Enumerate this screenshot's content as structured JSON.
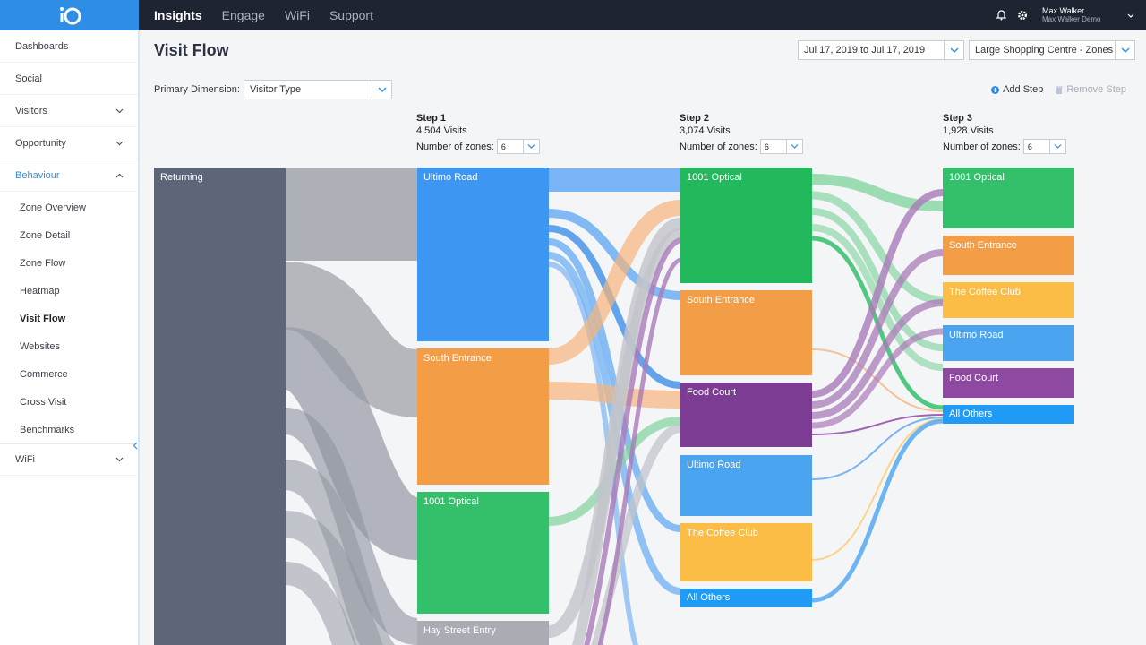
{
  "topbar": {
    "nav": [
      {
        "label": "Insights",
        "active": true
      },
      {
        "label": "Engage",
        "active": false
      },
      {
        "label": "WiFi",
        "active": false
      },
      {
        "label": "Support",
        "active": false
      }
    ],
    "user_name": "Max Walker",
    "user_org": "Max Walker Demo"
  },
  "sidebar": {
    "items": [
      {
        "label": "Dashboards"
      },
      {
        "label": "Social"
      },
      {
        "label": "Visitors"
      },
      {
        "label": "Opportunity"
      },
      {
        "label": "Behaviour"
      }
    ],
    "behaviour_sub": [
      "Zone Overview",
      "Zone Detail",
      "Zone Flow",
      "Heatmap",
      "Visit Flow",
      "Websites",
      "Commerce",
      "Cross Visit",
      "Benchmarks"
    ],
    "current": "Visit Flow",
    "wifi": "WiFi"
  },
  "page": {
    "title": "Visit Flow",
    "date_range": "Jul 17, 2019 to Jul 17, 2019",
    "venue": "Large Shopping Centre - Zones",
    "primary_dimension_label": "Primary Dimension:",
    "primary_dimension_value": "Visitor Type",
    "add_step": "Add Step",
    "remove_step": "Remove Step"
  },
  "steps": [
    {
      "title": "Step 1",
      "visits": "4,504 Visits",
      "zones_label": "Number of zones:",
      "zones_value": "6"
    },
    {
      "title": "Step 2",
      "visits": "3,074 Visits",
      "zones_label": "Number of zones:",
      "zones_value": "6"
    },
    {
      "title": "Step 3",
      "visits": "1,928 Visits",
      "zones_label": "Number of zones:",
      "zones_value": "6"
    }
  ],
  "flow": {
    "source": {
      "label": "Returning"
    },
    "step1": [
      {
        "label": "Ultimo Road"
      },
      {
        "label": "South Entrance"
      },
      {
        "label": "1001 Optical"
      },
      {
        "label": "Hay Street Entry"
      }
    ],
    "step2": [
      {
        "label": "1001 Optical"
      },
      {
        "label": "South Entrance"
      },
      {
        "label": "Food Court"
      },
      {
        "label": "Ultimo Road"
      },
      {
        "label": "The Coffee Club"
      },
      {
        "label": "All Others"
      }
    ],
    "step3": [
      {
        "label": "1001 Optical"
      },
      {
        "label": "South Entrance"
      },
      {
        "label": "The Coffee Club"
      },
      {
        "label": "Ultimo Road"
      },
      {
        "label": "Food Court"
      },
      {
        "label": "All Others"
      }
    ],
    "colors": {
      "returning": "#5d6678",
      "blue": "#3d97f2",
      "orange": "#f49d47",
      "green": "#34c06a",
      "gray": "#a9acb3",
      "purple": "#8e4aa1",
      "yellow": "#fbbd45",
      "lightblue": "#4ba4f0",
      "brightblue": "#1f9bf5"
    }
  }
}
